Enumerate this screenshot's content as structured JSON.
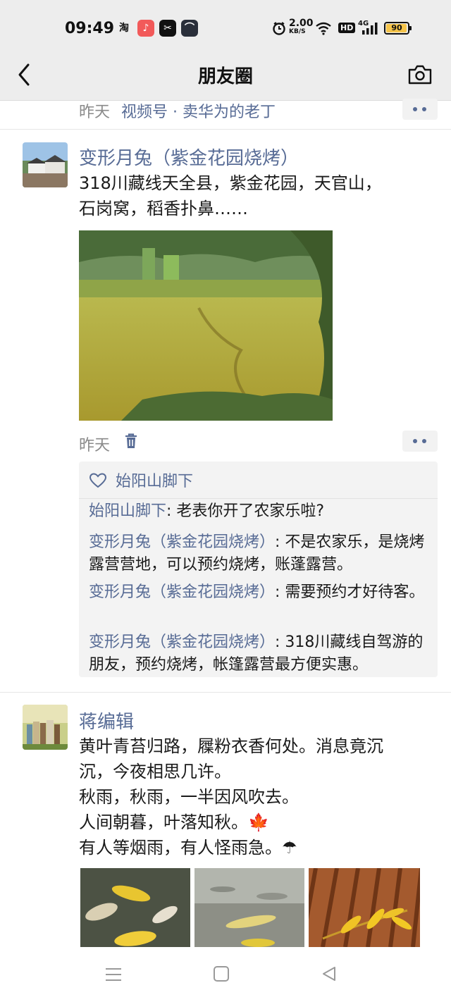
{
  "status_bar": {
    "time": "09:49",
    "apps": [
      "taobao-icon",
      "music-icon",
      "capcut-icon",
      "app-icon"
    ],
    "taobao_glyph": "淘",
    "network_speed": "2.00",
    "network_unit": "KB/S",
    "hd": "HD",
    "net_type": "4G",
    "battery": "90"
  },
  "nav": {
    "title": "朋友圈"
  },
  "top_post": {
    "time": "昨天",
    "source": "视频号 · 卖华为的老丁"
  },
  "post1": {
    "author": "变形月兔（紫金花园烧烤）",
    "text_line1": "318川藏线天全县，紫金花园，天官山，",
    "text_line2": "石岗窝，稻香扑鼻……",
    "time": "昨天",
    "likes": "始阳山脚下",
    "comments": [
      {
        "author": "始阳山脚下",
        "sep": ": ",
        "text": "老表你开了农家乐啦?"
      },
      {
        "author": "变形月兔（紫金花园烧烤）",
        "sep": ": ",
        "text": "不是农家乐，是烧烤露营营地，可以预约烧烤，账蓬露营。"
      },
      {
        "author": "变形月兔（紫金花园烧烤）",
        "sep": ": ",
        "text": "需要预约才好待客。"
      },
      {
        "author": "变形月兔（紫金花园烧烤）",
        "sep": ": ",
        "text": "318川藏线自驾游的朋友，预约烧烤，帐篷露营最方便实惠。"
      }
    ]
  },
  "post2": {
    "author": "蒋编辑",
    "lines": [
      "黄叶青苔归路，屧粉衣香何处。消息竟沉",
      "沉，今夜相思几许。",
      "秋雨，秋雨，一半因风吹去。",
      "人间朝暮，叶落知秋。🍁",
      "有人等烟雨，有人怪雨急。☂"
    ]
  },
  "colors": {
    "link": "#576b95",
    "bar_bg": "#ededed",
    "comment_bg": "#f3f3f3"
  }
}
